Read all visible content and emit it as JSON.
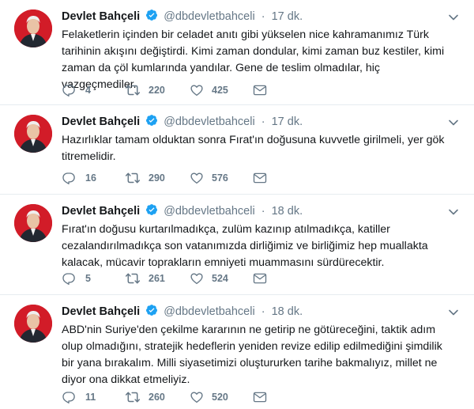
{
  "colors": {
    "name": "#14171a",
    "meta": "#657786",
    "verified": "#1da1f2",
    "avatar_background": "#d21c28",
    "divider": "#e6ecf0"
  },
  "icons": {
    "reply": "speech-bubble-icon",
    "retweet": "retweet-icon",
    "like": "heart-icon",
    "message": "envelope-icon",
    "menu": "chevron-down-icon",
    "verified": "verified-badge-icon"
  },
  "tweets": [
    {
      "author": "Devlet Bahçeli",
      "handle": "@dbdevletbahceli",
      "separator": "·",
      "time": "17 dk.",
      "text": "Felaketlerin içinden bir celadet anıtı gibi yükselen nice kahramanımız Türk tarihinin akışını değiştirdi. Kimi zaman dondular, kimi zaman buz kestiler, kimi zaman da çöl kumlarında yandılar. Gene de teslim olmadılar, hiç vazgeçmediler.",
      "replies": "4",
      "retweets": "220",
      "likes": "425"
    },
    {
      "author": "Devlet Bahçeli",
      "handle": "@dbdevletbahceli",
      "separator": "·",
      "time": "17 dk.",
      "text": "Hazırlıklar tamam olduktan sonra Fırat'ın doğusuna kuvvetle girilmeli, yer gök titremelidir.",
      "replies": "16",
      "retweets": "290",
      "likes": "576"
    },
    {
      "author": "Devlet Bahçeli",
      "handle": "@dbdevletbahceli",
      "separator": "·",
      "time": "18 dk.",
      "text": "Fırat'ın doğusu kurtarılmadıkça, zulüm kazınıp atılmadıkça, katiller cezalandırılmadıkça son vatanımızda dirliğimiz ve birliğimiz hep muallakta kalacak, mücavir toprakların emniyeti muammasını sürdürecektir.",
      "replies": "5",
      "retweets": "261",
      "likes": "524"
    },
    {
      "author": "Devlet Bahçeli",
      "handle": "@dbdevletbahceli",
      "separator": "·",
      "time": "18 dk.",
      "text": "ABD'nin Suriye'den çekilme kararının ne getirip ne götüreceğini, taktik adım olup olmadığını, stratejik hedeflerin yeniden revize edilip edilmediğini şimdilik bir yana bırakalım. Milli siyasetimizi oluştururken tarihe bakmalıyız, millet ne diyor ona dikkat etmeliyiz.",
      "replies": "11",
      "retweets": "260",
      "likes": "520"
    }
  ]
}
